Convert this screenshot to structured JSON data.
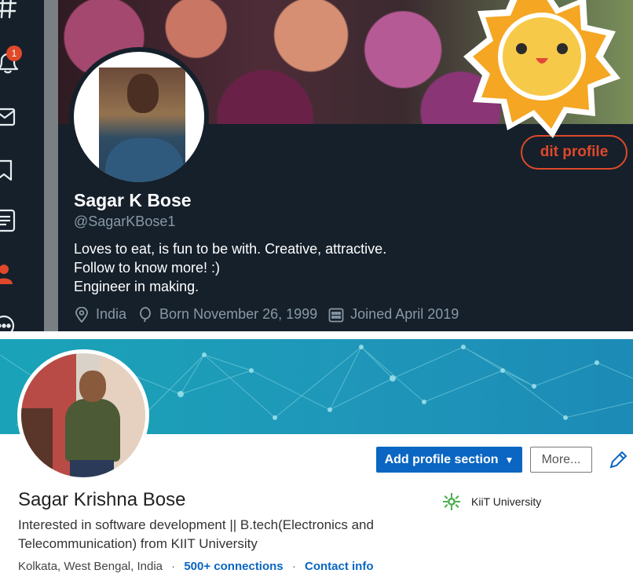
{
  "twitter": {
    "rail": {
      "notification_count": "1",
      "items": [
        "hashtag-icon",
        "bell-icon",
        "mail-icon",
        "bookmark-icon",
        "list-icon",
        "profile-icon",
        "more-icon"
      ]
    },
    "profile": {
      "name": "Sagar K Bose",
      "handle": "@SagarKBose1",
      "bio_lines": [
        "Loves to eat, is fun to be with. Creative, attractive.",
        "Follow to know more! :)",
        "Engineer in making."
      ],
      "location": "India",
      "born": "Born November 26, 1999",
      "joined": "Joined April 2019",
      "edit_button_label": "dit profile"
    },
    "colors": {
      "background": "#15202b",
      "accent": "#e0482a",
      "muted_text": "#8899a6"
    }
  },
  "linkedin": {
    "name": "Sagar Krishna Bose",
    "headline_lines": [
      "Interested in software development || B.tech(Electronics and",
      "Telecommunication) from KIIT University"
    ],
    "location": "Kolkata, West Bengal, India",
    "separator": "·",
    "connections": "500+ connections",
    "contact_info": "Contact info",
    "add_section_label": "Add profile section",
    "more_label": "More...",
    "school": "KiiT University",
    "colors": {
      "primary_button": "#0a66c2",
      "banner": "#1f97b9"
    }
  }
}
